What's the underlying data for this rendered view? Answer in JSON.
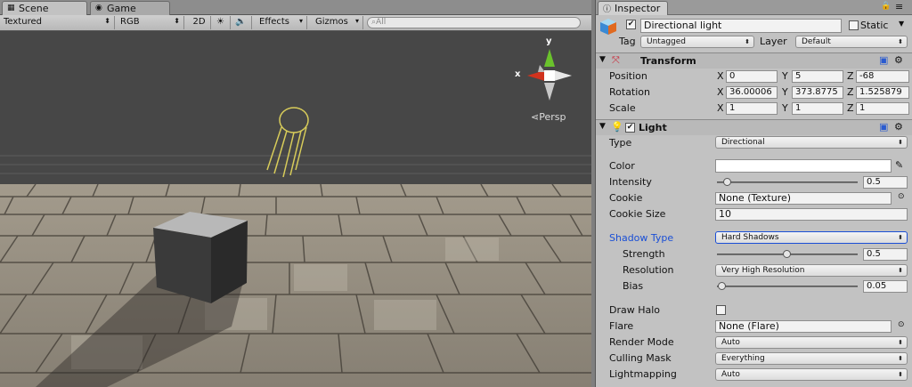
{
  "tabs": {
    "scene": "Scene",
    "game": "Game",
    "inspector": "Inspector"
  },
  "toolbar": {
    "render_mode": "Textured",
    "color_mode": "RGB",
    "mode_2d": "2D",
    "effects": "Effects",
    "gizmos": "Gizmos",
    "search_placeholder": "All"
  },
  "gizmo": {
    "y": "y",
    "x": "x",
    "persp": "Persp"
  },
  "object": {
    "name": "Directional light",
    "static_label": "Static",
    "tag_label": "Tag",
    "tag_value": "Untagged",
    "layer_label": "Layer",
    "layer_value": "Default"
  },
  "transform": {
    "title": "Transform",
    "position": {
      "label": "Position",
      "x": "0",
      "y": "5",
      "z": "-68"
    },
    "rotation": {
      "label": "Rotation",
      "x": "36.00006",
      "y": "373.8775",
      "z": "1.525879"
    },
    "scale": {
      "label": "Scale",
      "x": "1",
      "y": "1",
      "z": "1"
    },
    "axis_x": "X",
    "axis_y": "Y",
    "axis_z": "Z"
  },
  "light": {
    "title": "Light",
    "type_label": "Type",
    "type_value": "Directional",
    "color_label": "Color",
    "intensity_label": "Intensity",
    "intensity_value": "0.5",
    "cookie_label": "Cookie",
    "cookie_value": "None (Texture)",
    "cookie_size_label": "Cookie Size",
    "cookie_size_value": "10",
    "shadow_type_label": "Shadow Type",
    "shadow_type_value": "Hard Shadows",
    "strength_label": "Strength",
    "strength_value": "0.5",
    "resolution_label": "Resolution",
    "resolution_value": "Very High Resolution",
    "bias_label": "Bias",
    "bias_value": "0.05",
    "draw_halo_label": "Draw Halo",
    "flare_label": "Flare",
    "flare_value": "None (Flare)",
    "render_mode_label": "Render Mode",
    "render_mode_value": "Auto",
    "culling_mask_label": "Culling Mask",
    "culling_mask_value": "Everything",
    "lightmapping_label": "Lightmapping",
    "lightmapping_value": "Auto"
  },
  "colors": {
    "accent_blue": "#1a4fd6",
    "gizmo_red": "#d0321d",
    "gizmo_green": "#6ac22c",
    "light_wire": "#d8cc5a"
  }
}
